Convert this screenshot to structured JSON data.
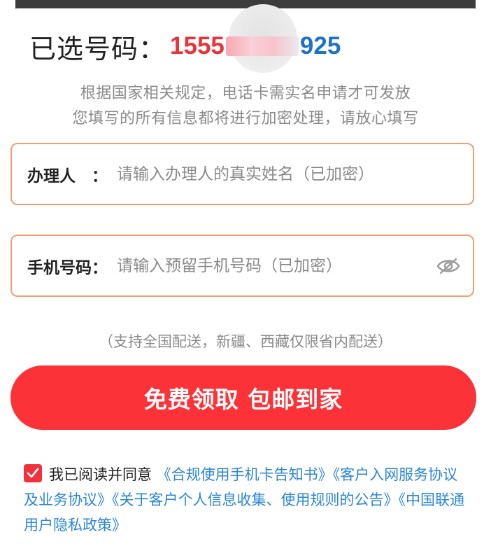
{
  "header": {
    "label": "已选号码：",
    "number_prefix": "1555",
    "number_suffix": "925"
  },
  "notice": {
    "line1": "根据国家相关规定，电话卡需实名申请才可发放",
    "line2": "您填写的所有信息都将进行加密处理，请放心填写"
  },
  "form": {
    "name_label": "办理人　：",
    "name_placeholder": "请输入办理人的真实姓名（已加密）",
    "phone_label": "手机号码：",
    "phone_placeholder": "请输入预留手机号码（已加密）"
  },
  "delivery_note": "（支持全国配送，新疆、西藏仅限省内配送）",
  "cta_label": "免费领取 包邮到家",
  "agreement": {
    "checked": true,
    "prefix": "我已阅读并同意",
    "links": [
      "《合规使用手机卡告知书》",
      "《客户入网服务协议及业务协议》",
      "《关于客户个人信息收集、使用规则的公告》",
      "《中国联通用户隐私政策》"
    ]
  },
  "icons": {
    "eye_toggle": "eye-off-icon",
    "checkbox": "check-icon"
  },
  "colors": {
    "accent_red": "#fb3238",
    "number_red": "#e8333a",
    "number_blue": "#1f72c9",
    "link_blue": "#2a86d8",
    "field_border": "#f0a070"
  }
}
